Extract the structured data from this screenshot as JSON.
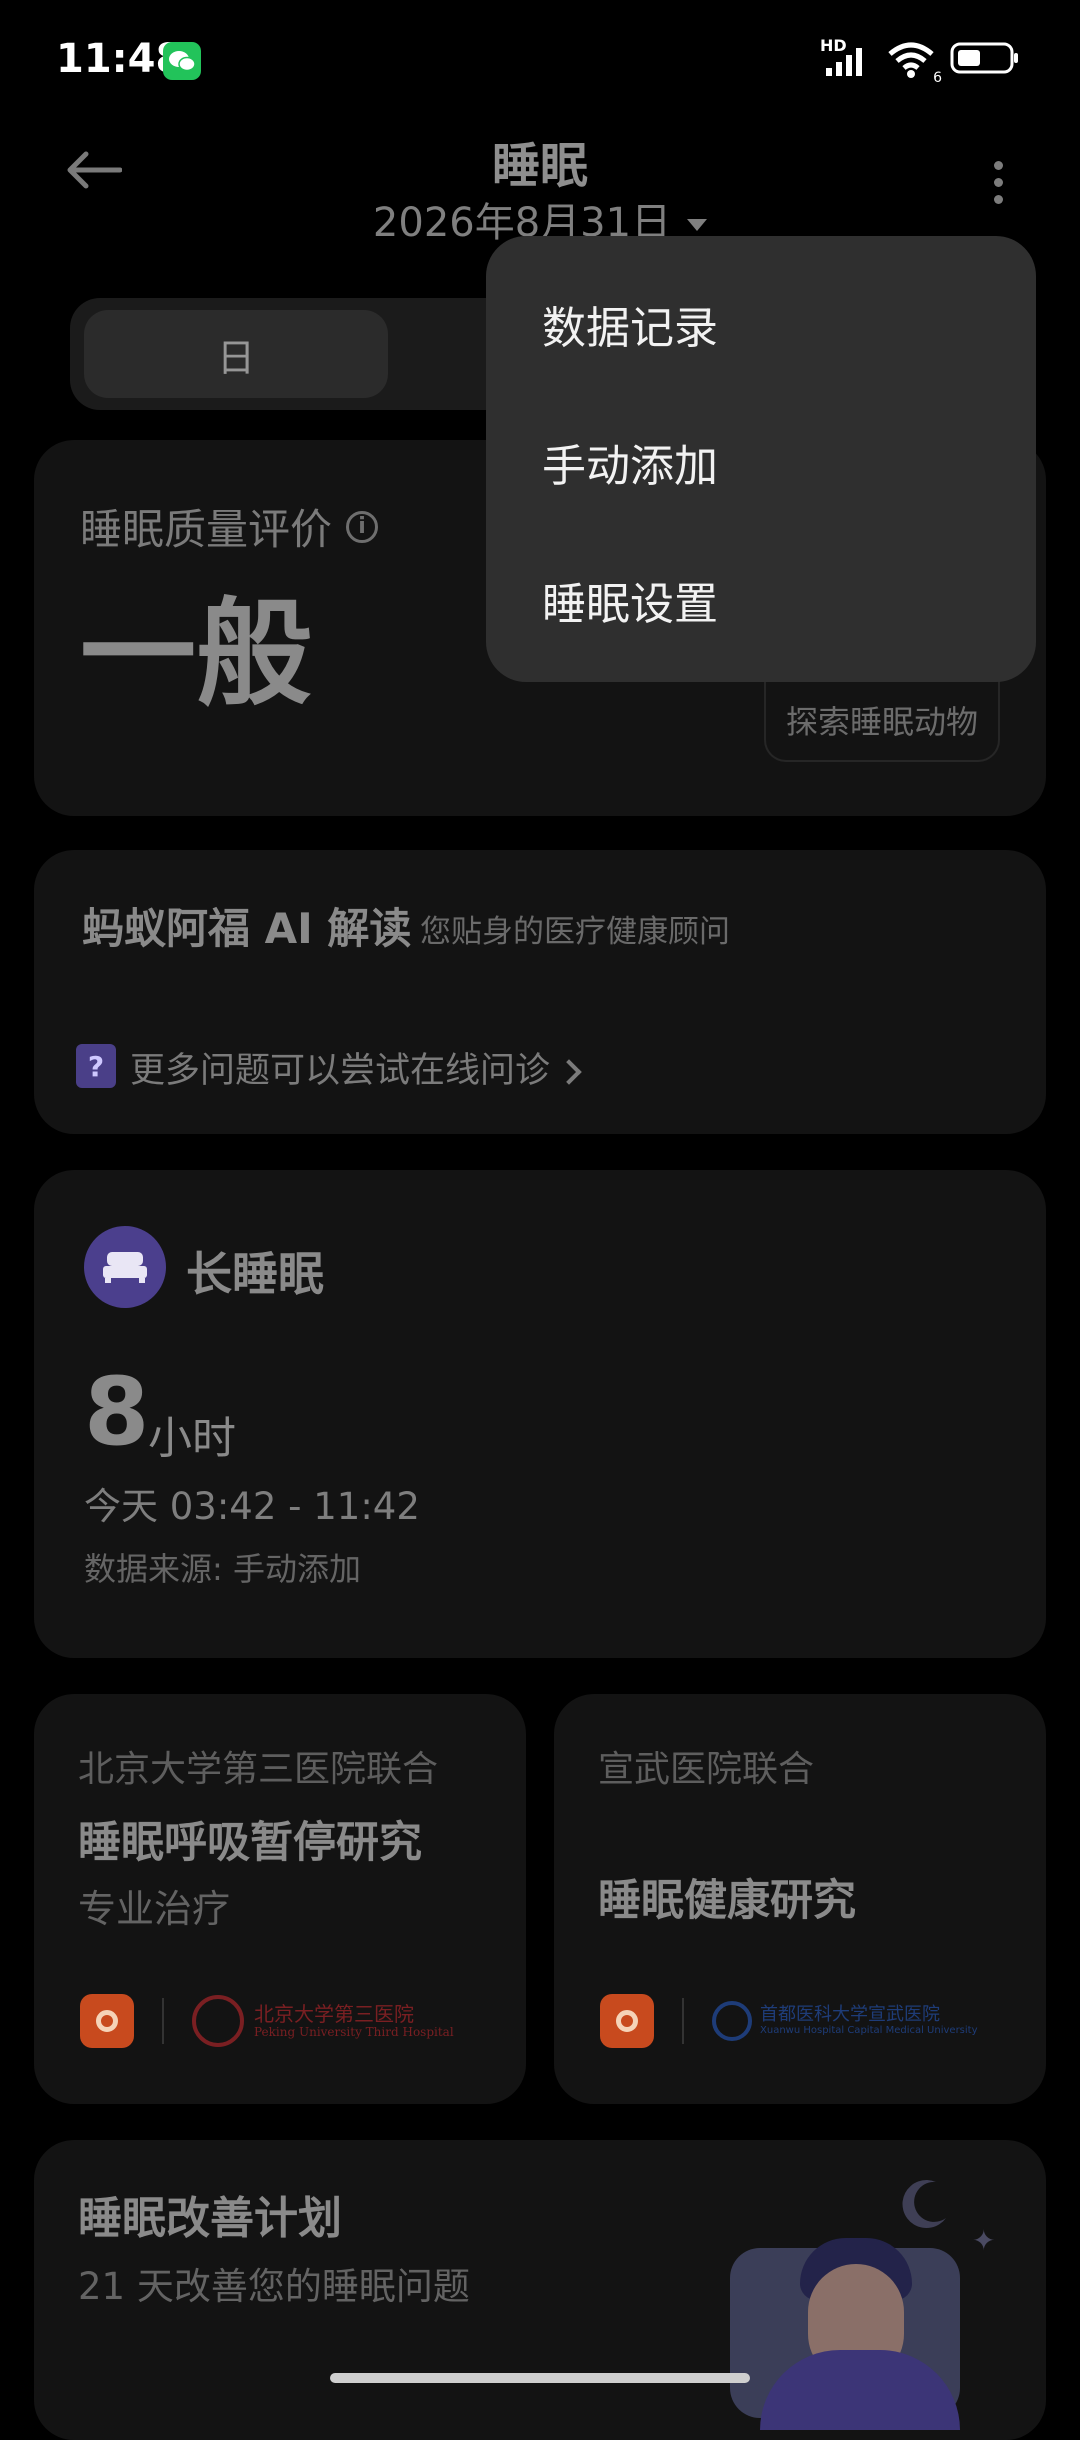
{
  "status_bar": {
    "time": "11:48",
    "network": "HD",
    "signal_sub": "6"
  },
  "header": {
    "title": "睡眠",
    "date": "2026年8月31日"
  },
  "tabs": {
    "day": "日"
  },
  "quality": {
    "label": "睡眠质量评价",
    "value": "一般",
    "explore": "探索睡眠动物"
  },
  "ai": {
    "title": "蚂蚁阿福 AI 解读",
    "subtitle": "您贴身的医疗健康顾问",
    "link": "更多问题可以尝试在线问诊",
    "icon_char": "?"
  },
  "long_sleep": {
    "title": "长睡眠",
    "hours": "8",
    "unit": "小时",
    "time_range": "今天 03:42 - 11:42",
    "source": "数据来源: 手动添加"
  },
  "studies": [
    {
      "institution": "北京大学第三医院联合",
      "title": "睡眠呼吸暂停研究",
      "subtitle": "专业治疗",
      "logo_text_cn": "北京大学第三医院",
      "logo_text_en": "Peking University Third Hospital"
    },
    {
      "institution": "宣武医院联合",
      "title": "睡眠健康研究",
      "logo_text_cn": "首都医科大学宣武医院",
      "logo_text_en": "Xuanwu Hospital Capital Medical University"
    }
  ],
  "plan": {
    "title": "睡眠改善计划",
    "subtitle": "21 天改善您的睡眠问题"
  },
  "menu": {
    "items": [
      "数据记录",
      "手动添加",
      "睡眠设置"
    ]
  },
  "colors": {
    "background": "#000000",
    "card": "#131313",
    "menu": "#2f2f2f",
    "accent_purple": "#4b3f8d",
    "wechat_green": "#22c35a"
  }
}
